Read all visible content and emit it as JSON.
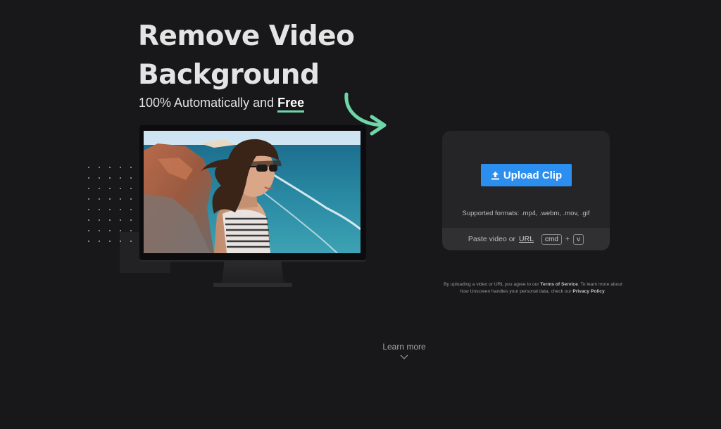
{
  "hero": {
    "title_line1": "Remove Video",
    "title_line2": "Background",
    "subtitle_prefix": "100% Automatically and",
    "subtitle_emphasis": "Free"
  },
  "upload": {
    "button_label": "Upload Clip",
    "icon": "upload-icon",
    "formats_text": "Supported formats: .mp4, .webm, .mov, .gif",
    "paste_prefix": "Paste video or",
    "paste_link": "URL",
    "key_cmd": "cmd",
    "key_plus": "+",
    "key_v": "v"
  },
  "legal": {
    "text_1": "By uploading a video or URL you agree to our",
    "tos_link": "Terms of Service",
    "text_2": ". To learn more about how Unscreen handles your personal data, check our",
    "privacy_link": "Privacy Policy",
    "text_3": "."
  },
  "footer": {
    "learn_more": "Learn more",
    "icon": "chevron-down-icon"
  },
  "colors": {
    "background": "#18181a",
    "accent_green": "#6fd6a8",
    "button_blue": "#2c8ff0",
    "card": "#252527"
  }
}
